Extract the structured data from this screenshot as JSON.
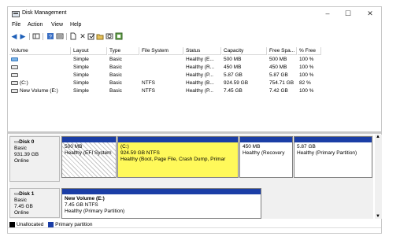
{
  "window": {
    "title": "Disk Management",
    "controls": {
      "minimize": "–",
      "maximize": "☐",
      "close": "✕"
    }
  },
  "menu": {
    "items": [
      "File",
      "Action",
      "View",
      "Help"
    ]
  },
  "volume_table": {
    "columns": [
      "Volume",
      "Layout",
      "Type",
      "File System",
      "Status",
      "Capacity",
      "Free Spa...",
      "% Free"
    ],
    "rows": [
      {
        "volume": "",
        "layout": "Simple",
        "type": "Basic",
        "fs": "",
        "status": "Healthy (E...",
        "capacity": "500 MB",
        "free": "500 MB",
        "pct": "100 %"
      },
      {
        "volume": "",
        "layout": "Simple",
        "type": "Basic",
        "fs": "",
        "status": "Healthy (R...",
        "capacity": "450 MB",
        "free": "450 MB",
        "pct": "100 %"
      },
      {
        "volume": "",
        "layout": "Simple",
        "type": "Basic",
        "fs": "",
        "status": "Healthy (P...",
        "capacity": "5.87 GB",
        "free": "5.87 GB",
        "pct": "100 %"
      },
      {
        "volume": "(C:)",
        "layout": "Simple",
        "type": "Basic",
        "fs": "NTFS",
        "status": "Healthy (B...",
        "capacity": "924.59 GB",
        "free": "754.71 GB",
        "pct": "82 %"
      },
      {
        "volume": "New Volume (E:)",
        "layout": "Simple",
        "type": "Basic",
        "fs": "NTFS",
        "status": "Healthy (P...",
        "capacity": "7.45 GB",
        "free": "7.42 GB",
        "pct": "100 %"
      }
    ]
  },
  "disks": [
    {
      "name": "Disk 0",
      "type": "Basic",
      "size": "931.39 GB",
      "state": "Online",
      "partitions": [
        {
          "title": "",
          "line1": "500 MB",
          "line2": "Healthy (EFI System"
        },
        {
          "title": "(C:)",
          "line1": "924.59 GB NTFS",
          "line2": "Healthy (Boot, Page File, Crash Dump, Primar"
        },
        {
          "title": "",
          "line1": "450 MB",
          "line2": "Healthy (Recovery"
        },
        {
          "title": "",
          "line1": "5.87 GB",
          "line2": "Healthy (Primary Partition)"
        }
      ]
    },
    {
      "name": "Disk 1",
      "type": "Basic",
      "size": "7.45 GB",
      "state": "Online",
      "partitions": [
        {
          "title": "New Volume (E:)",
          "line1": "7.45 GB NTFS",
          "line2": "Healthy (Primary Partition)"
        }
      ]
    }
  ],
  "legend": {
    "unallocated": "Unallocated",
    "primary": "Primary partition"
  },
  "colors": {
    "primary_bar": "#1b3ea6",
    "unallocated": "#000000",
    "selection": "#fff95a"
  }
}
